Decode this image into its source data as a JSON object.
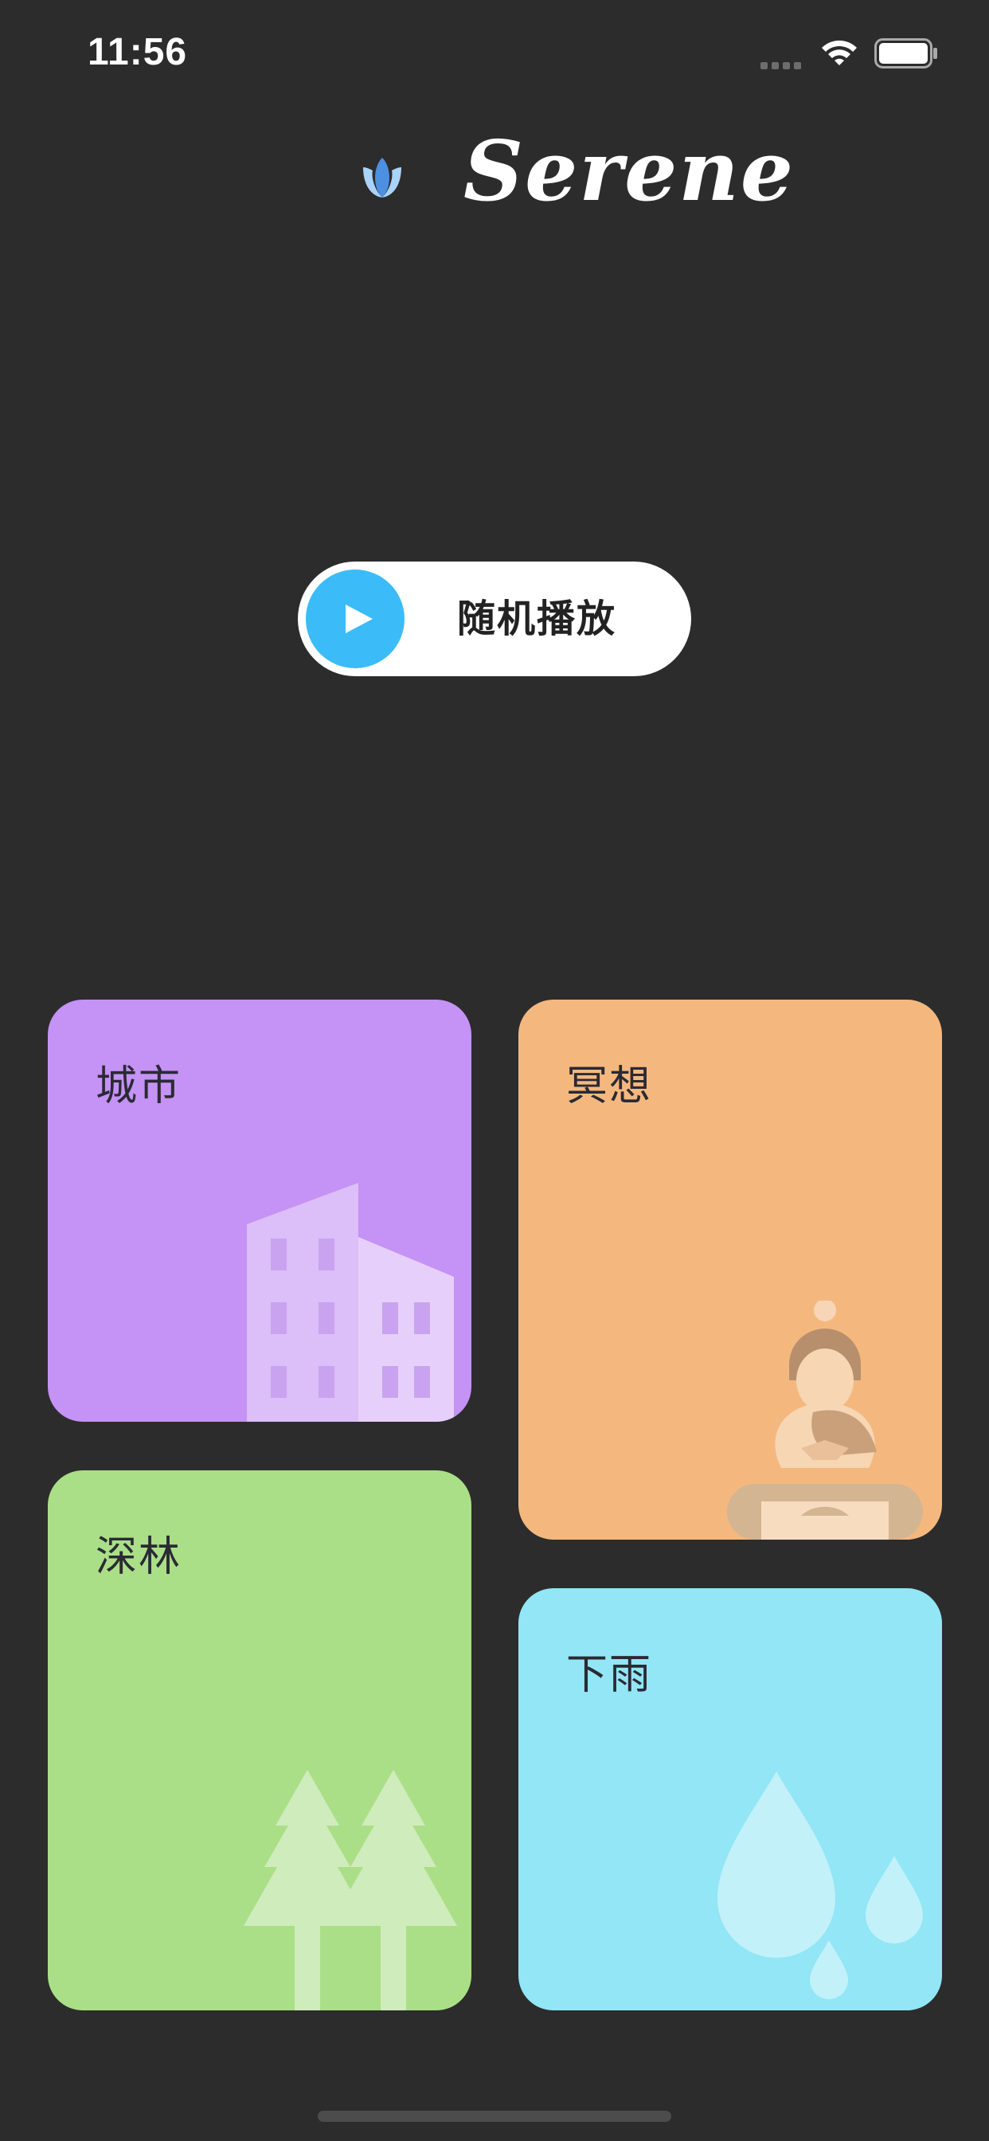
{
  "status_bar": {
    "time": "11:56"
  },
  "header": {
    "app_name": "Serene",
    "logo_icon": "lotus-icon"
  },
  "shuffle": {
    "label": "随机播放",
    "icon": "play-icon",
    "accent_color": "#3bbcf8"
  },
  "categories": [
    {
      "title": "城市",
      "icon": "buildings-icon",
      "color": "#c592f5"
    },
    {
      "title": "冥想",
      "icon": "meditation-figure-icon",
      "color": "#f4b87f"
    },
    {
      "title": "深林",
      "icon": "trees-icon",
      "color": "#aadf87"
    },
    {
      "title": "下雨",
      "icon": "raindrops-icon",
      "color": "#92e6f5"
    }
  ],
  "colors": {
    "background": "#2c2c2c"
  }
}
